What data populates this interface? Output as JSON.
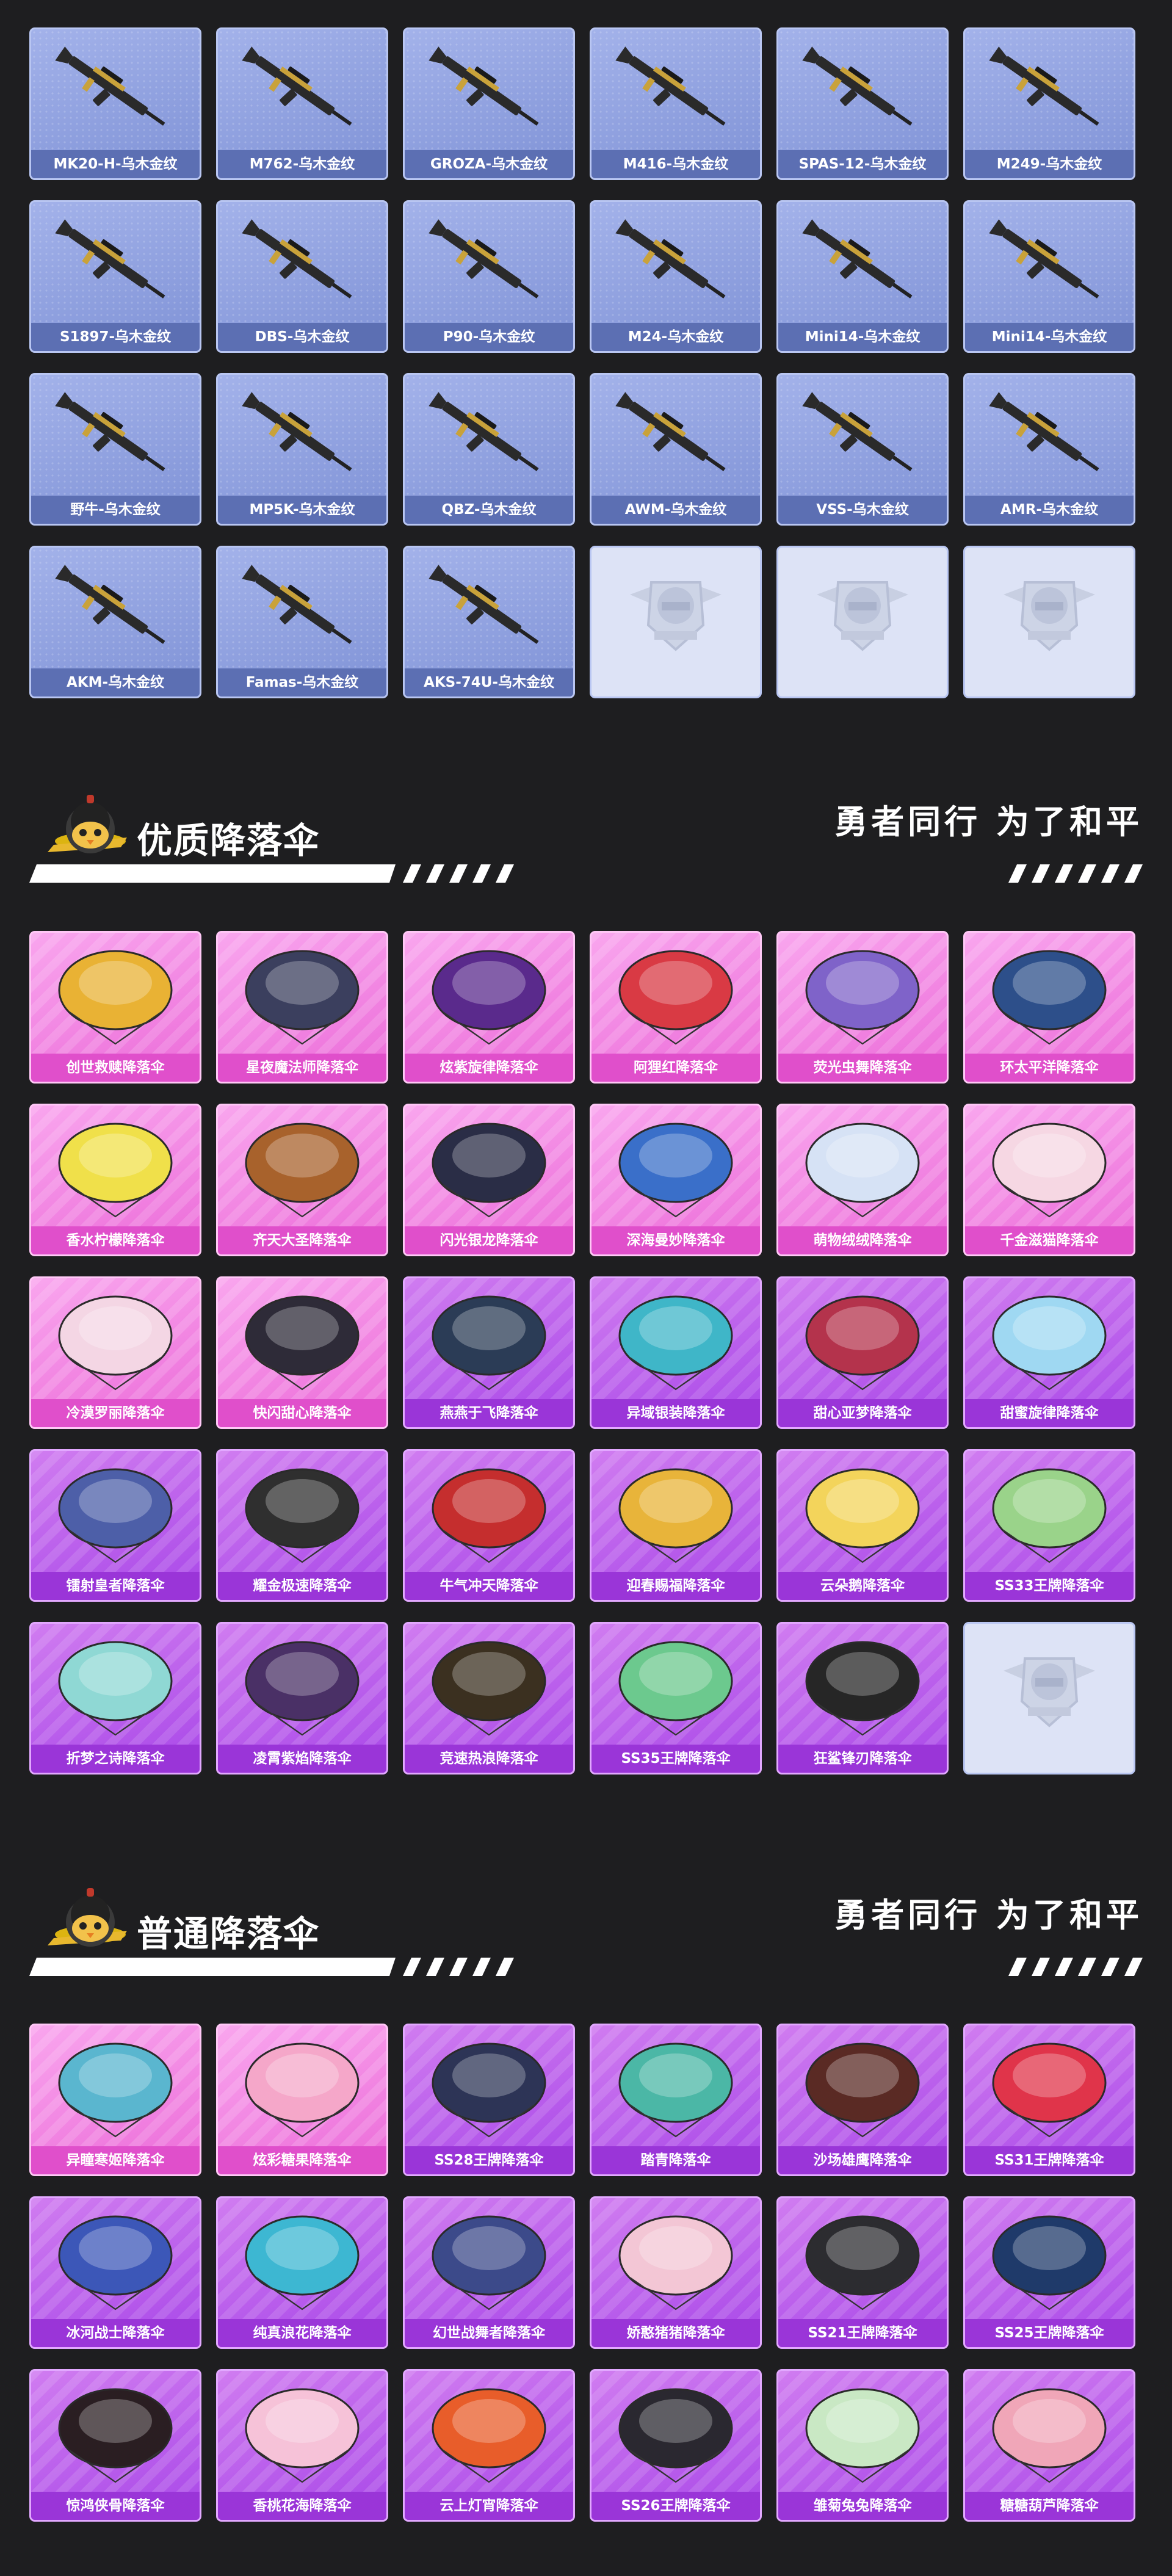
{
  "guns": [
    {
      "label": "MK20-H-乌木金纹",
      "icon": "rifle-icon"
    },
    {
      "label": "M762-乌木金纹",
      "icon": "rifle-icon"
    },
    {
      "label": "GROZA-乌木金纹",
      "icon": "rifle-icon"
    },
    {
      "label": "M416-乌木金纹",
      "icon": "rifle-icon"
    },
    {
      "label": "SPAS-12-乌木金纹",
      "icon": "shotgun-icon"
    },
    {
      "label": "M249-乌木金纹",
      "icon": "machine-gun-icon"
    },
    {
      "label": "S1897-乌木金纹",
      "icon": "shotgun-icon"
    },
    {
      "label": "DBS-乌木金纹",
      "icon": "shotgun-icon"
    },
    {
      "label": "P90-乌木金纹",
      "icon": "smg-icon"
    },
    {
      "label": "M24-乌木金纹",
      "icon": "sniper-icon"
    },
    {
      "label": "Mini14-乌木金纹",
      "icon": "rifle-icon"
    },
    {
      "label": "Mini14-乌木金纹",
      "icon": "rifle-icon"
    },
    {
      "label": "野牛-乌木金纹",
      "icon": "smg-icon"
    },
    {
      "label": "MP5K-乌木金纹",
      "icon": "smg-icon"
    },
    {
      "label": "QBZ-乌木金纹",
      "icon": "rifle-icon"
    },
    {
      "label": "AWM-乌木金纹",
      "icon": "sniper-icon"
    },
    {
      "label": "VSS-乌木金纹",
      "icon": "sniper-icon"
    },
    {
      "label": "AMR-乌木金纹",
      "icon": "sniper-icon"
    },
    {
      "label": "AKM-乌木金纹",
      "icon": "rifle-icon"
    },
    {
      "label": "Famas-乌木金纹",
      "icon": "rifle-icon"
    },
    {
      "label": "AKS-74U-乌木金纹",
      "icon": "rifle-icon"
    }
  ],
  "sections": [
    {
      "title": "优质降落伞",
      "slogan": "勇者同行 为了和平",
      "items": [
        {
          "label": "创世救赎降落伞",
          "color": "#e9b234",
          "style": "pink"
        },
        {
          "label": "星夜魔法师降落伞",
          "color": "#3b3f5e",
          "style": "pink"
        },
        {
          "label": "炫紫旋律降落伞",
          "color": "#5a2a8c",
          "style": "pink"
        },
        {
          "label": "阿狸红降落伞",
          "color": "#d93a44",
          "style": "pink"
        },
        {
          "label": "荧光虫舞降落伞",
          "color": "#7f63c9",
          "style": "pink"
        },
        {
          "label": "环太平洋降落伞",
          "color": "#2d4f8a",
          "style": "pink"
        },
        {
          "label": "香水柠檬降落伞",
          "color": "#f0e04a",
          "style": "pink"
        },
        {
          "label": "齐天大圣降落伞",
          "color": "#a8622c",
          "style": "pink"
        },
        {
          "label": "闪光银龙降落伞",
          "color": "#2a2d46",
          "style": "pink"
        },
        {
          "label": "深海曼妙降落伞",
          "color": "#3a6fc9",
          "style": "pink"
        },
        {
          "label": "萌物绒绒降落伞",
          "color": "#d6e2f5",
          "style": "pink"
        },
        {
          "label": "千金滋猫降落伞",
          "color": "#f6d7e3",
          "style": "pink"
        },
        {
          "label": "冷漠罗丽降落伞",
          "color": "#f4d6e4",
          "style": "pink"
        },
        {
          "label": "快闪甜心降落伞",
          "color": "#2e2b38",
          "style": "pink"
        },
        {
          "label": "燕燕于飞降落伞",
          "color": "#2b3c56",
          "style": "purple"
        },
        {
          "label": "异域银装降落伞",
          "color": "#3fb6c8",
          "style": "purple"
        },
        {
          "label": "甜心亚梦降落伞",
          "color": "#b4334c",
          "style": "purple"
        },
        {
          "label": "甜蜜旋律降落伞",
          "color": "#9fd8f2",
          "style": "purple"
        },
        {
          "label": "镭射皇者降落伞",
          "color": "#4d5fa8",
          "style": "purple"
        },
        {
          "label": "耀金极速降落伞",
          "color": "#2f2f2f",
          "style": "purple"
        },
        {
          "label": "牛气冲天降落伞",
          "color": "#c52e2e",
          "style": "purple"
        },
        {
          "label": "迎春赐福降落伞",
          "color": "#e8b43a",
          "style": "purple"
        },
        {
          "label": "云朵鹅降落伞",
          "color": "#f3d45b",
          "style": "purple"
        },
        {
          "label": "SS33王牌降落伞",
          "color": "#9ad38a",
          "style": "purple"
        },
        {
          "label": "折梦之诗降落伞",
          "color": "#8fd8d4",
          "style": "purple"
        },
        {
          "label": "凌霄紫焰降落伞",
          "color": "#4a3066",
          "style": "purple"
        },
        {
          "label": "竞速热浪降落伞",
          "color": "#3b3020",
          "style": "purple"
        },
        {
          "label": "SS35王牌降落伞",
          "color": "#6cc98e",
          "style": "purple"
        },
        {
          "label": "狂鲨锋刃降落伞",
          "color": "#262626",
          "style": "purple"
        }
      ]
    },
    {
      "title": "普通降落伞",
      "slogan": "勇者同行 为了和平",
      "items": [
        {
          "label": "异瞳寒姬降落伞",
          "color": "#5ab6cf",
          "style": "pink"
        },
        {
          "label": "炫彩糖果降落伞",
          "color": "#f5a7c9",
          "style": "pink"
        },
        {
          "label": "SS28王牌降落伞",
          "color": "#2d3456",
          "style": "purple"
        },
        {
          "label": "踏青降落伞",
          "color": "#4bb7a6",
          "style": "purple"
        },
        {
          "label": "沙场雄鹰降落伞",
          "color": "#5a2a24",
          "style": "purple"
        },
        {
          "label": "SS31王牌降落伞",
          "color": "#e0344a",
          "style": "purple"
        },
        {
          "label": "冰河战士降落伞",
          "color": "#3c57b8",
          "style": "purple"
        },
        {
          "label": "纯真浪花降落伞",
          "color": "#3db7d2",
          "style": "purple"
        },
        {
          "label": "幻世战舞者降落伞",
          "color": "#3c4a8a",
          "style": "purple"
        },
        {
          "label": "娇憨猪猪降落伞",
          "color": "#f3c6d5",
          "style": "purple"
        },
        {
          "label": "SS21王牌降落伞",
          "color": "#2c2c30",
          "style": "purple"
        },
        {
          "label": "SS25王牌降落伞",
          "color": "#1f3a6a",
          "style": "purple"
        },
        {
          "label": "惊鸿侠骨降落伞",
          "color": "#2a1e22",
          "style": "purple"
        },
        {
          "label": "香桃花海降落伞",
          "color": "#f6c2d8",
          "style": "purple"
        },
        {
          "label": "云上灯宵降落伞",
          "color": "#e85d2a",
          "style": "purple"
        },
        {
          "label": "SS26王牌降落伞",
          "color": "#2a2830",
          "style": "purple"
        },
        {
          "label": "雏菊兔兔降落伞",
          "color": "#c9e8c4",
          "style": "purple"
        },
        {
          "label": "糖糖葫芦降落伞",
          "color": "#f0a6b8",
          "style": "purple"
        }
      ]
    }
  ]
}
